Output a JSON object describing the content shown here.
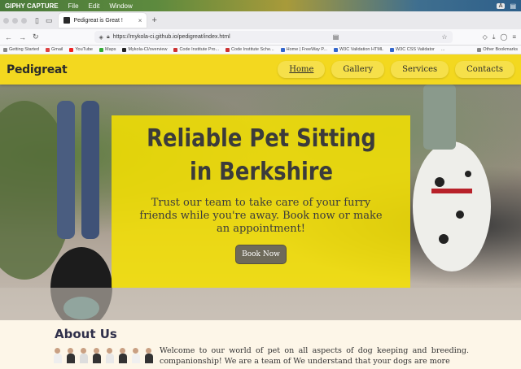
{
  "menubar": {
    "app_name": "GIPHY CAPTURE",
    "items": [
      "File",
      "Edit",
      "Window"
    ],
    "badge": "A"
  },
  "browser": {
    "tab_title": "Pedigreat is Great !",
    "url": "https://mykola-ci.github.io/pedigreat/index.html",
    "bookmarks": [
      "Getting Started",
      "Gmail",
      "YouTube",
      "Maps",
      "Mykola-CI/overview",
      "Code Institute Pro...",
      "Code Institute Sche...",
      "Home | FreeWay P...",
      "W3C Validation HTML",
      "W3C CSS Validator",
      "...",
      "Other Bookmarks"
    ]
  },
  "site": {
    "brand": "Pedigreat",
    "nav": [
      "Home",
      "Gallery",
      "Services",
      "Contacts"
    ],
    "hero": {
      "title": "Reliable Pet Sitting in Berkshire",
      "subtitle": "Trust our team to take care of your furry friends while you're away. Book now or make an appointment!",
      "button": "Book Now"
    },
    "about": {
      "title": "About Us",
      "text": "Welcome to our world of pet on all aspects of dog keeping and breeding. companionship! We are a team of We understand that your dogs are more"
    }
  },
  "colors": {
    "header_yellow": "#f3d81f",
    "hero_overlay": "#f5e100",
    "text_dark": "#3b3b3b",
    "button_gray": "#6e6a5a"
  }
}
